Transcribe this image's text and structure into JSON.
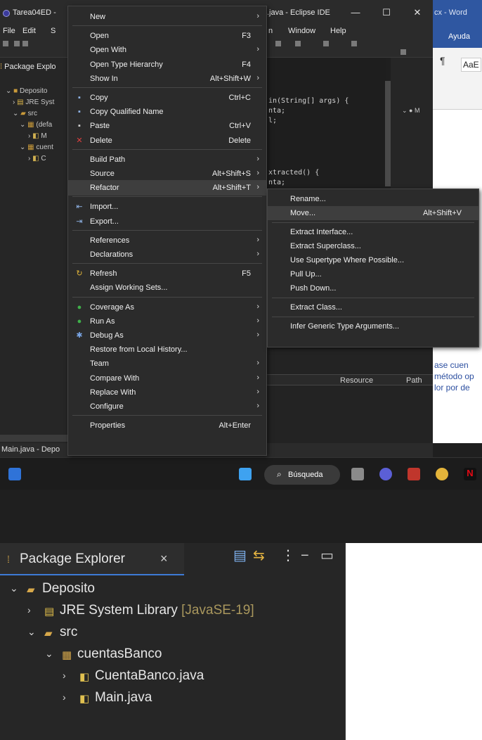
{
  "eclipse": {
    "title_left": "Tarea04ED -",
    "title_right": ".java - Eclipse IDE",
    "menubar": [
      "File",
      "Edit",
      "S",
      "n",
      "Window",
      "Help"
    ],
    "package_explorer_short": "Package Explo",
    "tree_short": [
      "Deposito",
      "JRE Syst",
      "src",
      "(defa",
      "M",
      "cuent",
      "C"
    ],
    "code_lines": [
      "in(String[] args) {",
      "nta;",
      "l;",
      "xtracted() {",
      "nta;"
    ],
    "status_text": "Main.java - Depo",
    "bottom_table_headers": [
      "Resource",
      "Path"
    ]
  },
  "word": {
    "title": "cx - Word",
    "ribbon_tab": "Ayuda",
    "style_gallery": "AaE",
    "fragments": [
      "ase cuen",
      "método op",
      "lor por de"
    ]
  },
  "context_menu": {
    "items": [
      {
        "label": "New",
        "shortcut": "",
        "submenu": true,
        "icon": ""
      },
      {
        "sep": true
      },
      {
        "label": "Open",
        "shortcut": "F3",
        "submenu": false,
        "icon": ""
      },
      {
        "label": "Open With",
        "shortcut": "",
        "submenu": true,
        "icon": ""
      },
      {
        "label": "Open Type Hierarchy",
        "shortcut": "F4",
        "submenu": false,
        "icon": ""
      },
      {
        "label": "Show In",
        "shortcut": "Alt+Shift+W",
        "submenu": true,
        "icon": ""
      },
      {
        "sep": true
      },
      {
        "label": "Copy",
        "shortcut": "Ctrl+C",
        "submenu": false,
        "icon": "copy-icon"
      },
      {
        "label": "Copy Qualified Name",
        "shortcut": "",
        "submenu": false,
        "icon": "copy-qualified-icon"
      },
      {
        "label": "Paste",
        "shortcut": "Ctrl+V",
        "submenu": false,
        "icon": "paste-icon"
      },
      {
        "label": "Delete",
        "shortcut": "Delete",
        "submenu": false,
        "icon": "delete-icon"
      },
      {
        "sep": true
      },
      {
        "label": "Build Path",
        "shortcut": "",
        "submenu": true,
        "icon": ""
      },
      {
        "label": "Source",
        "shortcut": "Alt+Shift+S",
        "submenu": true,
        "icon": ""
      },
      {
        "label": "Refactor",
        "shortcut": "Alt+Shift+T",
        "submenu": true,
        "icon": "",
        "highlight": true
      },
      {
        "sep": true
      },
      {
        "label": "Import...",
        "shortcut": "",
        "submenu": false,
        "icon": "import-icon"
      },
      {
        "label": "Export...",
        "shortcut": "",
        "submenu": false,
        "icon": "export-icon"
      },
      {
        "sep": true
      },
      {
        "label": "References",
        "shortcut": "",
        "submenu": true,
        "icon": ""
      },
      {
        "label": "Declarations",
        "shortcut": "",
        "submenu": true,
        "icon": ""
      },
      {
        "sep": true
      },
      {
        "label": "Refresh",
        "shortcut": "F5",
        "submenu": false,
        "icon": "refresh-icon"
      },
      {
        "label": "Assign Working Sets...",
        "shortcut": "",
        "submenu": false,
        "icon": ""
      },
      {
        "sep": true
      },
      {
        "label": "Coverage As",
        "shortcut": "",
        "submenu": true,
        "icon": "coverage-icon"
      },
      {
        "label": "Run As",
        "shortcut": "",
        "submenu": true,
        "icon": "run-icon"
      },
      {
        "label": "Debug As",
        "shortcut": "",
        "submenu": true,
        "icon": "debug-icon"
      },
      {
        "label": "Restore from Local History...",
        "shortcut": "",
        "submenu": false,
        "icon": ""
      },
      {
        "label": "Team",
        "shortcut": "",
        "submenu": true,
        "icon": ""
      },
      {
        "label": "Compare With",
        "shortcut": "",
        "submenu": true,
        "icon": ""
      },
      {
        "label": "Replace With",
        "shortcut": "",
        "submenu": true,
        "icon": ""
      },
      {
        "label": "Configure",
        "shortcut": "",
        "submenu": true,
        "icon": ""
      },
      {
        "sep": true
      },
      {
        "label": "Properties",
        "shortcut": "Alt+Enter",
        "submenu": false,
        "icon": ""
      }
    ]
  },
  "refactor_submenu": {
    "items": [
      {
        "label": "Rename...",
        "shortcut": ""
      },
      {
        "label": "Move...",
        "shortcut": "Alt+Shift+V",
        "highlight": true
      },
      {
        "sep": true
      },
      {
        "label": "Extract Interface...",
        "shortcut": ""
      },
      {
        "label": "Extract Superclass...",
        "shortcut": ""
      },
      {
        "label": "Use Supertype Where Possible...",
        "shortcut": ""
      },
      {
        "label": "Pull Up...",
        "shortcut": ""
      },
      {
        "label": "Push Down...",
        "shortcut": ""
      },
      {
        "sep": true
      },
      {
        "label": "Extract Class...",
        "shortcut": ""
      },
      {
        "sep": true
      },
      {
        "label": "Infer Generic Type Arguments...",
        "shortcut": ""
      }
    ]
  },
  "taskbar": {
    "search_label": "Búsqueda"
  },
  "package_explorer": {
    "tab_title": "Package Explorer",
    "tree": [
      {
        "label": "Deposito",
        "decoration": "",
        "twisty": "open",
        "icon": "project-icon",
        "depth": 0
      },
      {
        "label": "JRE System Library",
        "decoration": "[JavaSE-19]",
        "twisty": "closed",
        "icon": "library-icon",
        "depth": 1
      },
      {
        "label": "src",
        "decoration": "",
        "twisty": "open",
        "icon": "source-folder-icon",
        "depth": 1
      },
      {
        "label": "cuentasBanco",
        "decoration": "",
        "twisty": "open",
        "icon": "package-icon",
        "depth": 2
      },
      {
        "label": "CuentaBanco.java",
        "decoration": "",
        "twisty": "closed",
        "icon": "java-file-icon",
        "depth": 3
      },
      {
        "label": "Main.java",
        "decoration": "",
        "twisty": "closed",
        "icon": "java-file-icon",
        "depth": 3
      }
    ]
  },
  "colors": {
    "dark_bg": "#1f1f1f",
    "menu_bg": "#2b2b2b",
    "word_blue": "#2f57a1",
    "tab_accent": "#3d7bd6",
    "package_icon": "#d7a84a"
  }
}
